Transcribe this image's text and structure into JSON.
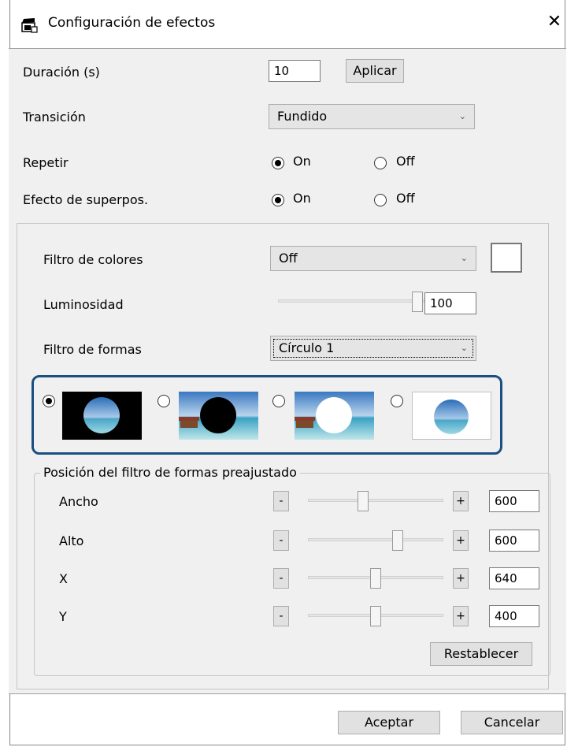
{
  "window": {
    "title": "Configuración de efectos",
    "close_glyph": "✕"
  },
  "duration": {
    "label": "Duración (s)",
    "value": "10",
    "apply_label": "Aplicar"
  },
  "transition": {
    "label": "Transición",
    "selected": "Fundido"
  },
  "repeat": {
    "label": "Repetir",
    "on_label": "On",
    "off_label": "Off",
    "selected": "On"
  },
  "overlay": {
    "label": "Efecto de superpos.",
    "on_label": "On",
    "off_label": "Off",
    "selected": "On"
  },
  "color_filter": {
    "label": "Filtro de colores",
    "selected": "Off",
    "swatch_color": "#ffffff"
  },
  "brightness": {
    "label": "Luminosidad",
    "value": "100",
    "slider_fraction": 1.0
  },
  "shape_filter": {
    "label": "Filtro de formas",
    "selected": "Círculo 1"
  },
  "shape_options": [
    {
      "name": "circle-1",
      "selected": true
    },
    {
      "name": "circle-2",
      "selected": false
    },
    {
      "name": "circle-3",
      "selected": false
    },
    {
      "name": "circle-4",
      "selected": false
    }
  ],
  "preset": {
    "legend": "Posición del filtro de formas preajustado",
    "minus_label": "-",
    "plus_label": "+",
    "rows": [
      {
        "label": "Ancho",
        "value": "600",
        "fraction": 0.4
      },
      {
        "label": "Alto",
        "value": "600",
        "fraction": 0.68
      },
      {
        "label": "X",
        "value": "640",
        "fraction": 0.5
      },
      {
        "label": "Y",
        "value": "400",
        "fraction": 0.5
      }
    ],
    "reset_label": "Restablecer"
  },
  "footer": {
    "ok_label": "Aceptar",
    "cancel_label": "Cancelar"
  },
  "colors": {
    "highlight_border": "#1a4f82",
    "dialog_bg": "#f0f0f0"
  }
}
